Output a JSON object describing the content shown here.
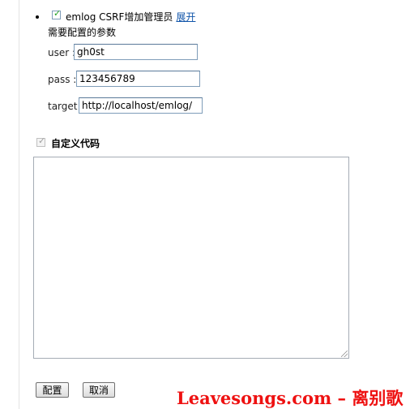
{
  "plugin": {
    "name": "emlog CSRF增加管理员",
    "toggle_link": "展开",
    "enabled": true
  },
  "params": {
    "heading": "需要配置的参数",
    "fields": [
      {
        "label": "user :",
        "value": "gh0st"
      },
      {
        "label": "pass :",
        "value": "123456789"
      },
      {
        "label": "target :",
        "value": "http://localhost/emlog/"
      }
    ]
  },
  "custom_code": {
    "label": "自定义代码",
    "checked": true,
    "disabled": true,
    "value": ""
  },
  "buttons": {
    "configure": "配置",
    "cancel": "取消"
  },
  "watermark": {
    "text": "Leavesongs.com – 离别歌",
    "color": "#ee1111"
  }
}
